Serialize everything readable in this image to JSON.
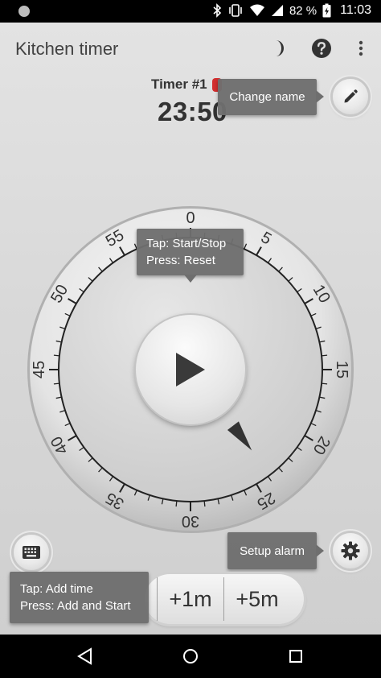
{
  "status_bar": {
    "battery_percent": "82 %",
    "time": "11:03"
  },
  "toolbar": {
    "title": "Kitchen timer"
  },
  "timer": {
    "name": "Timer #1",
    "value": "23:50"
  },
  "tooltips": {
    "change_name": "Change name",
    "start_stop_line1": "Tap: Start/Stop",
    "start_stop_line2": "Press: Reset",
    "setup_alarm": "Setup alarm",
    "add_time_line1": "Tap: Add time",
    "add_time_line2": "Press: Add and Start"
  },
  "dial": {
    "labels": [
      "0",
      "5",
      "10",
      "15",
      "20",
      "25",
      "30",
      "35",
      "40",
      "45",
      "50",
      "55"
    ],
    "pointer_minute": 23.8
  },
  "add_buttons": {
    "plus_1m": "+1m",
    "plus_5m": "+5m"
  },
  "colors": {
    "background": "#d9d9d9",
    "tooltip": "#6e6e6e",
    "text_dark": "#333333",
    "accent_red": "#d32f2f"
  },
  "icons": {
    "night_mode": "crescent-moon-icon",
    "help": "help-circle-icon",
    "more": "more-vert-icon",
    "edit": "pencil-icon",
    "play": "play-icon",
    "keyboard": "keyboard-icon",
    "settings": "gear-icon"
  }
}
